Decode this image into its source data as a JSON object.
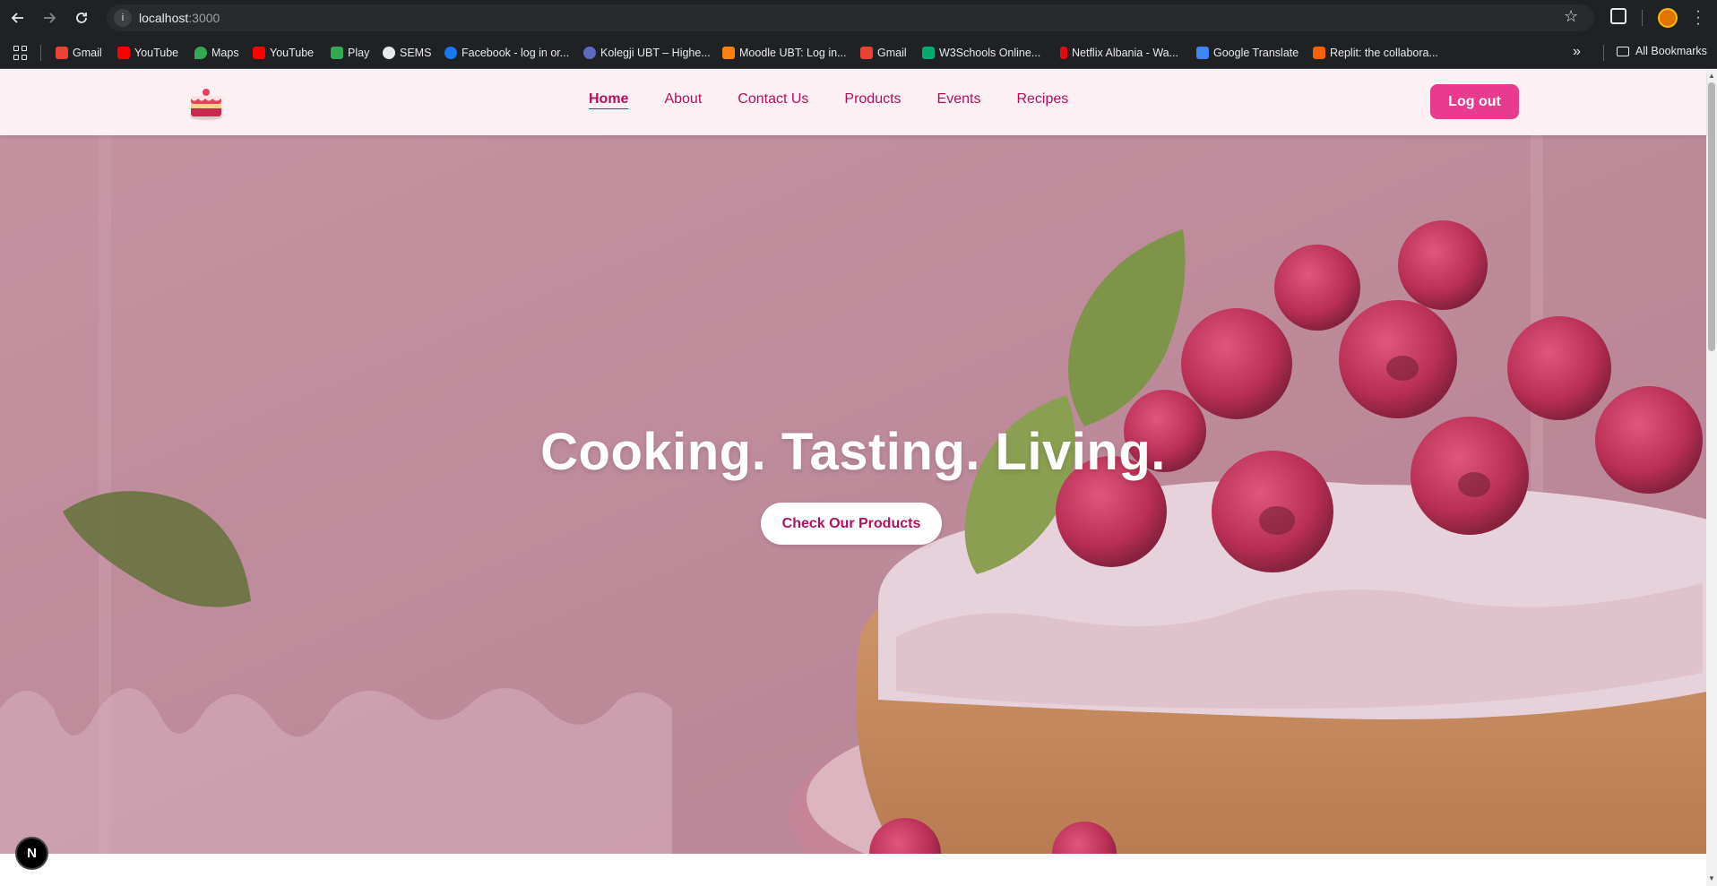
{
  "browser": {
    "url_host": "localhost",
    "url_port": ":3000",
    "bookmarks": [
      {
        "label": "Gmail",
        "color": "#ea4335"
      },
      {
        "label": "YouTube",
        "color": "#ff0000"
      },
      {
        "label": "Maps",
        "color": "#34a853"
      },
      {
        "label": "YouTube",
        "color": "#ff0000"
      },
      {
        "label": "Play",
        "color": "#34a853"
      },
      {
        "label": "SEMS",
        "color": "#e8eaed"
      },
      {
        "label": "Facebook - log in or...",
        "color": "#1877f2"
      },
      {
        "label": "Kolegji UBT – Highe...",
        "color": "#5c6bc0"
      },
      {
        "label": "Moodle UBT: Log in...",
        "color": "#f98012"
      },
      {
        "label": "Gmail",
        "color": "#ea4335"
      },
      {
        "label": "W3Schools Online...",
        "color": "#04aa6d"
      },
      {
        "label": "Netflix Albania - Wa...",
        "color": "#e50914"
      },
      {
        "label": "Google Translate",
        "color": "#4285f4"
      },
      {
        "label": "Replit: the collabora...",
        "color": "#f26207"
      }
    ],
    "all_bookmarks": "All Bookmarks"
  },
  "site": {
    "nav": {
      "links": [
        "Home",
        "About",
        "Contact Us",
        "Products",
        "Events",
        "Recipes"
      ],
      "active": "Home",
      "logout": "Log out"
    },
    "hero": {
      "title": "Cooking. Tasting. Living.",
      "cta": "Check Our Products"
    },
    "badge": "N"
  },
  "colors": {
    "accent": "#e83a8f",
    "nav_text": "#b0105f",
    "nav_bg": "#fdf0f5"
  }
}
